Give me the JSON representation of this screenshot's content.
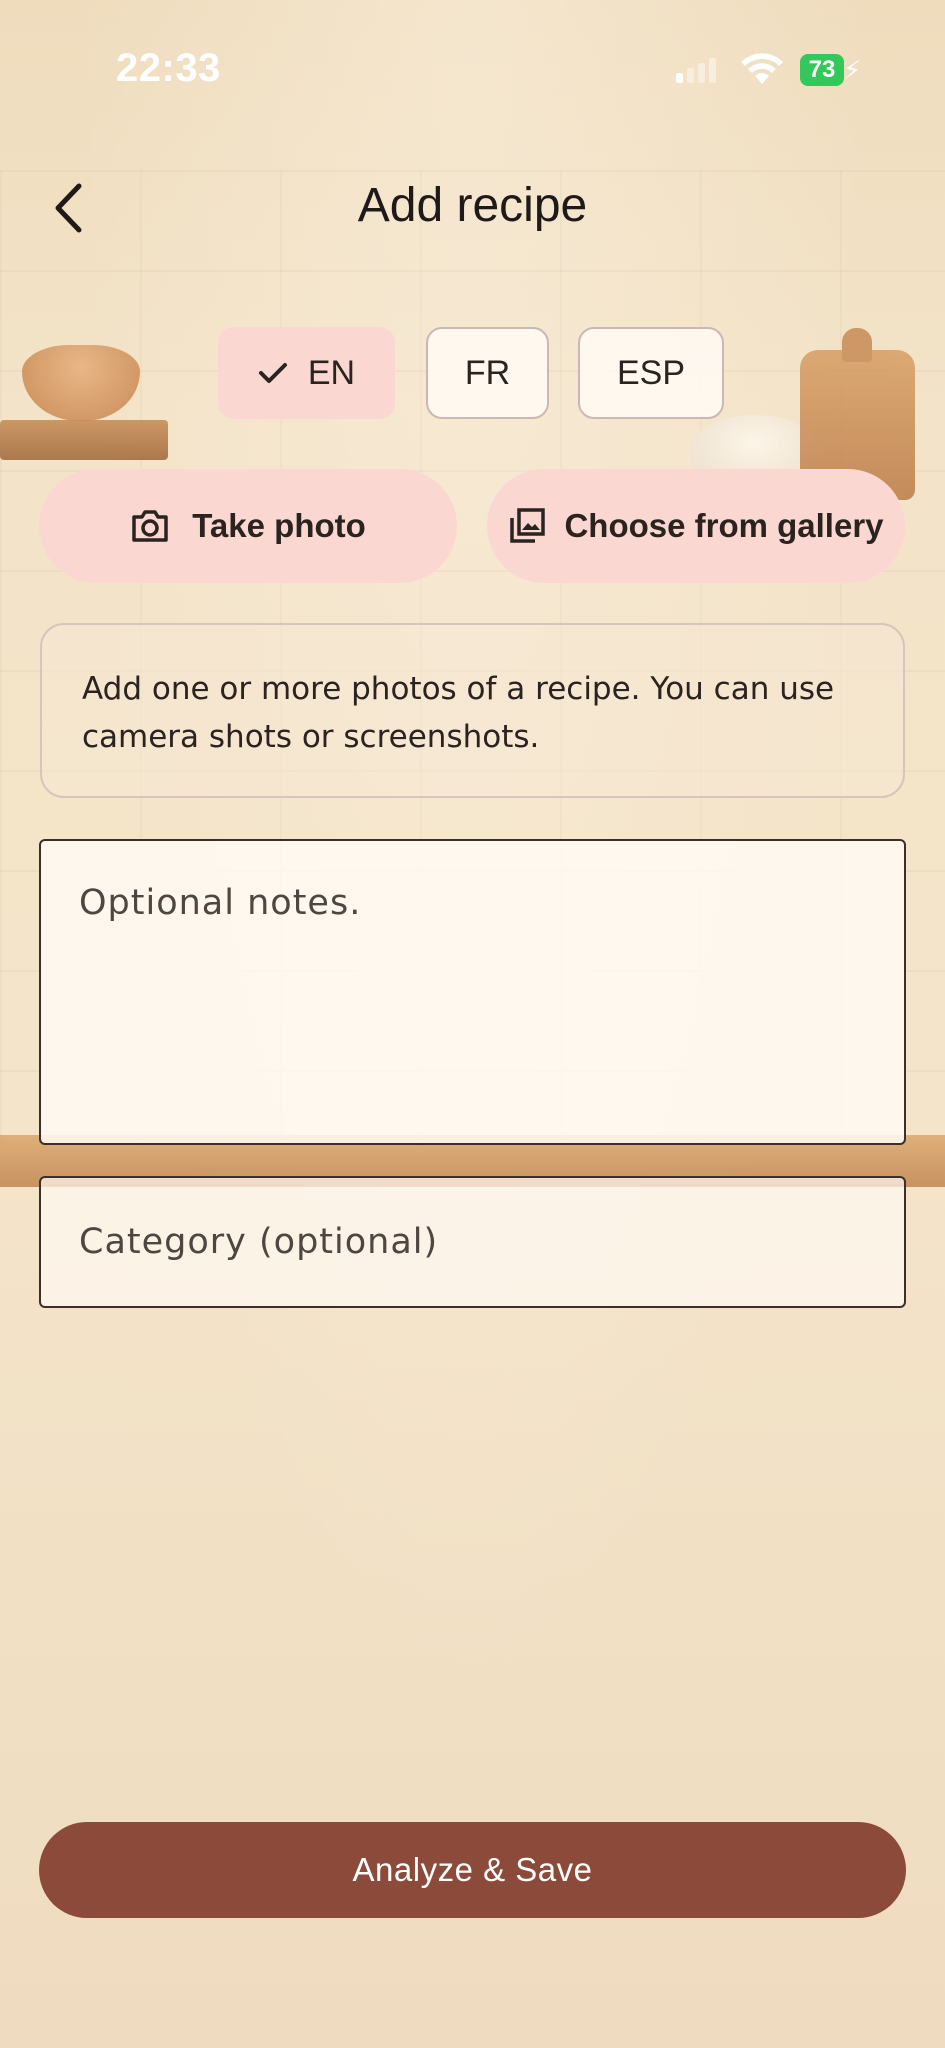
{
  "status_bar": {
    "time": "22:33",
    "battery_level": "73"
  },
  "header": {
    "title": "Add recipe",
    "back_icon": "chevron-left-icon"
  },
  "languages": [
    {
      "label": "EN",
      "selected": true
    },
    {
      "label": "FR",
      "selected": false
    },
    {
      "label": "ESP",
      "selected": false
    }
  ],
  "photo_actions": {
    "take_photo": {
      "label": "Take photo",
      "icon": "camera-icon"
    },
    "gallery": {
      "label": "Choose from gallery",
      "icon": "gallery-icon"
    }
  },
  "info_text": "Add one or more photos of a recipe. You can use camera shots or screenshots.",
  "notes": {
    "placeholder": "Optional notes.",
    "value": ""
  },
  "category": {
    "placeholder": "Category (optional)",
    "value": ""
  },
  "primary_action": {
    "label": "Analyze & Save"
  },
  "colors": {
    "accent_pill": "#fad7d1",
    "primary_button": "#8c4a3a",
    "battery": "#34c759"
  }
}
